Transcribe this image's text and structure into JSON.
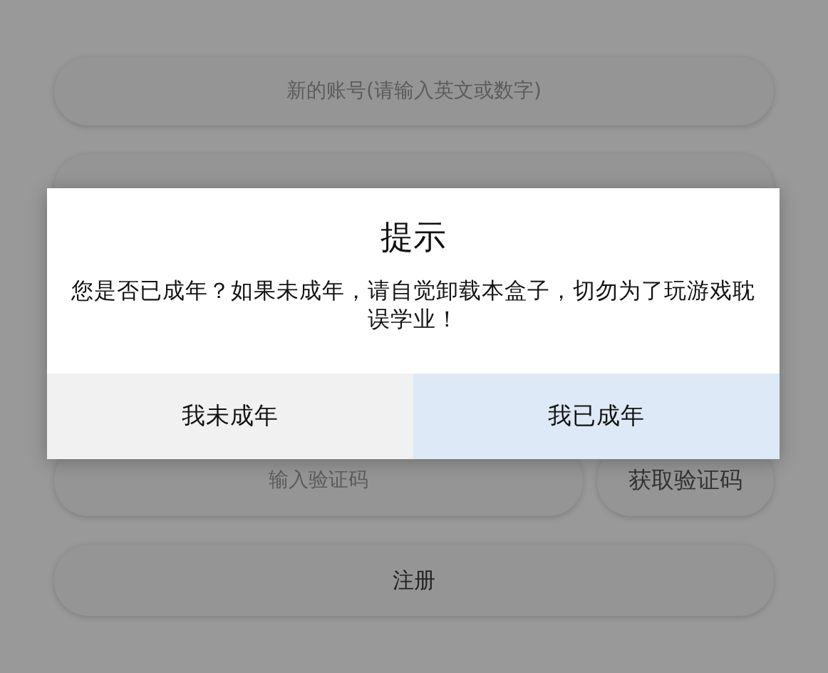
{
  "form": {
    "account_field": {
      "placeholder": "新的账号(请输入英文或数字)"
    },
    "code_field": {
      "placeholder": "输入验证码"
    },
    "get_code_button": "获取验证码",
    "register_button": "注册"
  },
  "dialog": {
    "title": "提示",
    "message": "您是否已成年？如果未成年，请自觉卸载本盒子，切勿为了玩游戏耽误学业！",
    "buttons": [
      {
        "label": "我未成年",
        "selected": false
      },
      {
        "label": "我已成年",
        "selected": true
      }
    ]
  }
}
